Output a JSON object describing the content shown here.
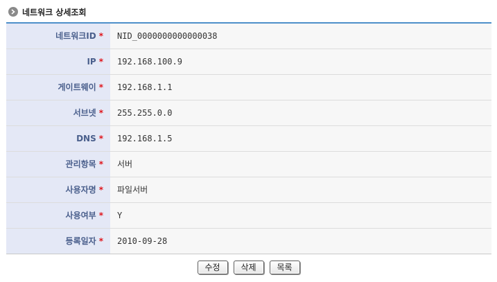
{
  "page": {
    "title": "네트워크 상세조회"
  },
  "fields": [
    {
      "label": "네트워크ID",
      "required": "*",
      "value": "NID_0000000000000038"
    },
    {
      "label": "IP",
      "required": "*",
      "value": "192.168.100.9"
    },
    {
      "label": "게이트웨이",
      "required": "*",
      "value": "192.168.1.1"
    },
    {
      "label": "서브넷",
      "required": "*",
      "value": "255.255.0.0"
    },
    {
      "label": "DNS",
      "required": "*",
      "value": "192.168.1.5"
    },
    {
      "label": "관리항목",
      "required": "*",
      "value": "서버"
    },
    {
      "label": "사용자명",
      "required": "*",
      "value": "파일서버"
    },
    {
      "label": "사용여부",
      "required": "*",
      "value": "Y"
    },
    {
      "label": "등록일자",
      "required": "*",
      "value": "2010-09-28"
    }
  ],
  "buttons": {
    "edit": "수정",
    "delete": "삭제",
    "list": "목록"
  },
  "icons": {
    "title_icon": "chevron-right-circle-icon"
  },
  "colors": {
    "header_line": "#4d8fc9",
    "label_bg": "#e4e8f6",
    "label_text": "#4a5f8c",
    "required_mark": "#e0151b",
    "value_bg": "#f7f7f7"
  }
}
